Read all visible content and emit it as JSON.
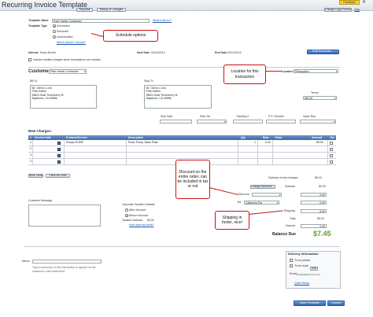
{
  "window": {
    "title": "Recurring Invoice Template",
    "badge": "Feedback"
  },
  "topbar": {
    "report_button": "Reports",
    "history_button": "History of Changes",
    "logo_button": "Change Logo/Theme",
    "help_link": "Help"
  },
  "template": {
    "name_label": "Template Name",
    "name_value": "Pete Harbin Contractor",
    "whats_this": "What's this for?",
    "type_label": "Template Type",
    "type_options": [
      "Scheduled",
      "Reminder",
      "Unscheduled"
    ],
    "which_link": "Which should I choose?",
    "interval_label": "Interval",
    "interval_value": "Every Month",
    "next_date_label": "Next Date",
    "next_date_value": "04/10/2013",
    "end_date_label": "End Date",
    "end_date_value": "02/10/2014",
    "edit_schedule": "Edit Schedule...",
    "unbilled_label": "Include unbilled charges when transactions are created."
  },
  "customer": {
    "label": "Customer",
    "value": "Pete Harbin Contractor",
    "location_label": "Location",
    "location_value": "Pleasanton",
    "bill_to_label": "Bill To",
    "bill_to_lines": [
      "Mr. Glenn L Lew",
      "Pete Harbin",
      "36521 East Thornberry St.",
      "Bayshore, CA 99556"
    ],
    "ship_to_label": "Ship To",
    "ship_to_lines": [
      "Mr. Glenn L Lew",
      "Pete Harbin",
      "36521 East Thornberry St.",
      "Bayshore, CA 99556"
    ],
    "terms_label": "Terms",
    "terms_value": "Net 30"
  },
  "shipping": {
    "headers": [
      "Ship Date",
      "Ship Via",
      "Tracking #",
      "P.O. Number",
      "Sales Rep"
    ]
  },
  "charges": {
    "title": "New Charges:",
    "headers": [
      "#",
      "Service Date",
      "Product/Service",
      "Description",
      "Qty",
      "Rate",
      "Class",
      "Amount",
      "Tax"
    ],
    "rows": [
      {
        "num": "1",
        "product": "Pumps:PUMP",
        "description": "Pulse Pump, Base Plate",
        "qty": "1",
        "rate": "5.00",
        "amount": "$5.00"
      },
      {
        "num": "2",
        "product": "",
        "description": "",
        "qty": "",
        "rate": "",
        "amount": ""
      },
      {
        "num": "3",
        "product": "",
        "description": "",
        "qty": "",
        "rate": "",
        "amount": ""
      },
      {
        "num": "4",
        "product": "",
        "description": "",
        "qty": "",
        "rate": "",
        "amount": ""
      }
    ],
    "more_lines": "More Lines",
    "clear_lines": "Clear All Lines"
  },
  "totals": {
    "subtotal_new_label": "Subtotal of new charges",
    "subtotal_new_value": "$5.00",
    "charge_accounts": "Charge Accounts...",
    "subtotal_label": "Subtotal",
    "subtotal_value": "$5.00",
    "discount_label": "Discount",
    "discount_value": "0.00",
    "tax_label": "Tax",
    "tax_select": "California Tax",
    "tax_value": "0.00",
    "shipping_label": "Shipping",
    "shipping_value": "5.00",
    "total_label": "Total",
    "total_value": "$5.00",
    "deposit_label": "Deposit",
    "deposit_value": "0.00",
    "balance_label": "Balance Due",
    "balance_value": "$7.45"
  },
  "calc": {
    "title": "Calculate Taxable Subtotal",
    "options": [
      "After discount",
      "Before discount"
    ],
    "taxable_label": "Taxable Subtotal",
    "taxable_value": "$5.00",
    "tax_help": "How does tax work?"
  },
  "message": {
    "label": "Customer Message"
  },
  "memo": {
    "label": "Memo",
    "hint_line1": "Type a summary of this transaction to appear on the",
    "hint_line2": "customer's next statement."
  },
  "delivery": {
    "title": "Delivery Information",
    "to_print": "To be printed",
    "to_email": "To be email",
    "edit_button": "Edit",
    "email_label": "Email:",
    "email_value": "charles@turbo.fix.com",
    "quick_setup": "Quick Setup"
  },
  "footer": {
    "save_button": "Save Template",
    "cancel_button": "Cancel"
  },
  "callouts": {
    "schedule": "Schedule options",
    "location": "Location for this transaction",
    "discount": "Discount on the entire order, can be included in tax or not",
    "shipping": "Shipping in footer, nice!"
  },
  "colors": {
    "callout_border": "#cc1212",
    "header_bar": "#3e6aa5",
    "balance": "#5aa02c",
    "primary_button": "#2f64b7"
  }
}
